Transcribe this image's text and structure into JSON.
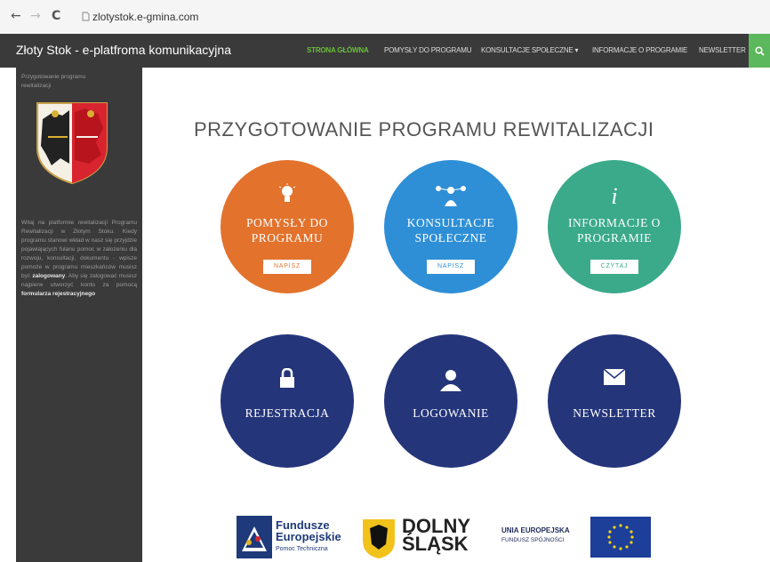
{
  "browser": {
    "back": "←",
    "forward": "→",
    "reload": "C",
    "url": "zlotystok.e-gmina.com"
  },
  "header": {
    "title": "Złoty Stok - e-platfroma komunikacyjna",
    "menu": [
      {
        "label": "STRONA GŁÓWNA",
        "active": true
      },
      {
        "label": "POMYSŁY DO PROGRAMU"
      },
      {
        "label": "KONSULTACJE SPOŁECZNE ▾"
      },
      {
        "label": "INFORMACJE O PROGRAMIE"
      },
      {
        "label": "NEWSLETTER"
      }
    ],
    "search_icon": "search-icon"
  },
  "sidebar": {
    "subtitle": "Przygotowanie programu rewitalizacji",
    "description_pre": "Witaj na platformie rewitalizacji Programu Rewitalizacji w Złotym Stoku. Kiedy programu stanowi wkład w nasz się przyjdzie pojawiających fulanu pomoc w założeniu dla rozwoju, konsultacji, dokumentu - wpisze pomoże w programu mieszkańców musisz być",
    "description_bold1": "zalogowany",
    "description_mid": ". Aby się zalogować musisz najpierw utworzyć konto za pomocą",
    "description_bold2": "formularza rejestracyjnego"
  },
  "main": {
    "heading": "PRZYGOTOWANIE PROGRAMU REWITALIZACJI",
    "tiles": [
      {
        "label": "POMYSŁY DO PROGRAMU",
        "button": "NAPISZ",
        "icon": "lightbulb-icon",
        "color": "#e2722c"
      },
      {
        "label": "KONSULTACJE SPOŁECZNE",
        "button": "NAPISZ",
        "icon": "people-network-icon",
        "color": "#2e8fd6"
      },
      {
        "label": "INFORMACJE O PROGRAMIE",
        "button": "CZYTAJ",
        "icon": "info-icon",
        "color": "#3aaa8b"
      },
      {
        "label": "REJESTRACJA",
        "icon": "lock-icon",
        "color": "#24357a"
      },
      {
        "label": "LOGOWANIE",
        "icon": "user-icon",
        "color": "#24357a"
      },
      {
        "label": "NEWSLETTER",
        "icon": "envelope-icon",
        "color": "#24357a"
      }
    ]
  },
  "footer": {
    "fe_line1": "Fundusze",
    "fe_line2": "Europejskie",
    "fe_line3": "Pomoc Techniczna",
    "ds_line1": "DOLNY",
    "ds_line2": "ŚLĄSK",
    "ue_line1": "UNIA EUROPEJSKA",
    "ue_line2": "FUNDUSZ SPÓJNOŚCI"
  }
}
